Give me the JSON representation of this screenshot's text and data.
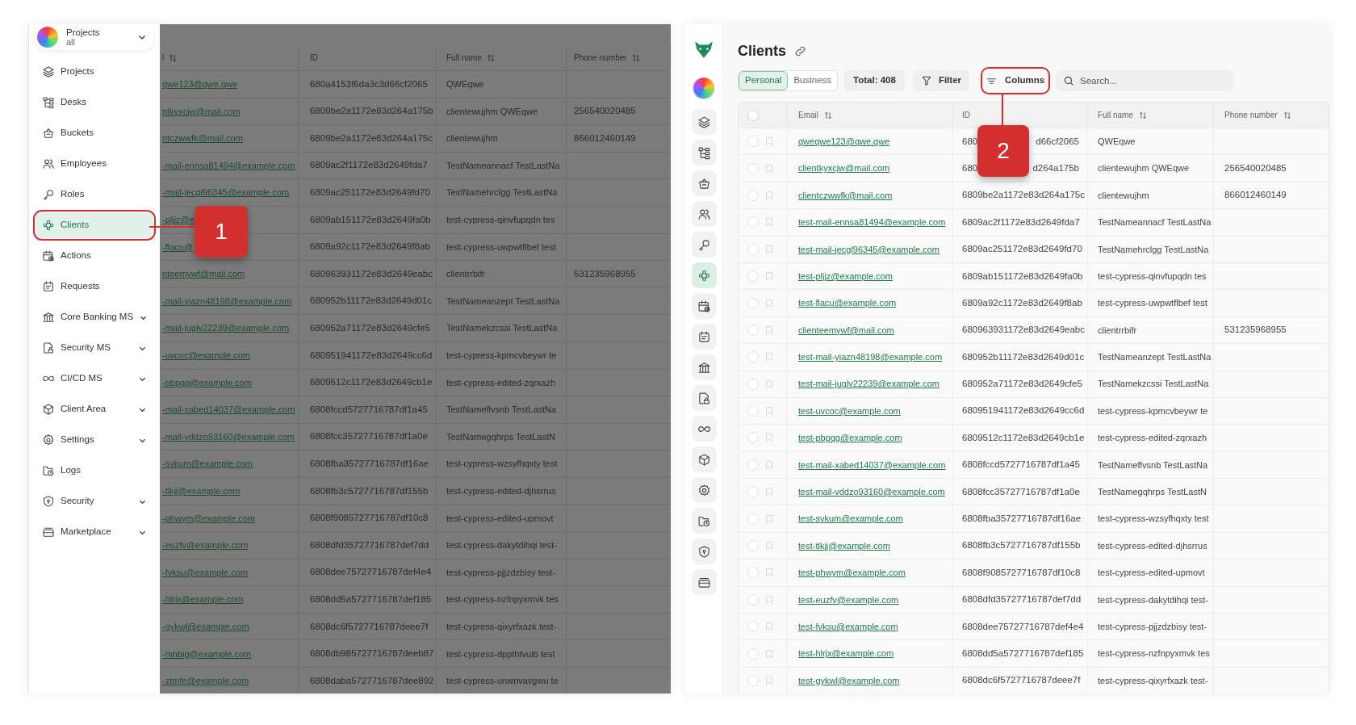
{
  "left_screen": {
    "project_selector": {
      "title": "Projects",
      "subtitle": "all"
    },
    "sidebar": {
      "items": [
        {
          "label": "Projects",
          "selected": false,
          "expandable": false
        },
        {
          "label": "Desks",
          "selected": false,
          "expandable": false
        },
        {
          "label": "Buckets",
          "selected": false,
          "expandable": false
        },
        {
          "label": "Employees",
          "selected": false,
          "expandable": false
        },
        {
          "label": "Roles",
          "selected": false,
          "expandable": false
        },
        {
          "label": "Clients",
          "selected": true,
          "expandable": false
        },
        {
          "label": "Actions",
          "selected": false,
          "expandable": false
        },
        {
          "label": "Requests",
          "selected": false,
          "expandable": false
        },
        {
          "label": "Core Banking MS",
          "selected": false,
          "expandable": true
        },
        {
          "label": "Security MS",
          "selected": false,
          "expandable": true
        },
        {
          "label": "CI/CD MS",
          "selected": false,
          "expandable": true
        },
        {
          "label": "Client Area",
          "selected": false,
          "expandable": true
        },
        {
          "label": "Settings",
          "selected": false,
          "expandable": true
        },
        {
          "label": "Logs",
          "selected": false,
          "expandable": false
        },
        {
          "label": "Security",
          "selected": false,
          "expandable": true
        },
        {
          "label": "Marketplace",
          "selected": false,
          "expandable": true
        }
      ]
    },
    "table": {
      "columns": [
        {
          "label": "l",
          "sortable": true
        },
        {
          "label": "ID",
          "sortable": false
        },
        {
          "label": "Full name",
          "sortable": true
        },
        {
          "label": "Phone number",
          "sortable": true
        }
      ],
      "rows": [
        {
          "email": "qwe123@qwe.qwe",
          "id": "680a4153f6da3c3d66cf2065",
          "full_name": "QWEqwe"
        },
        {
          "email": "ntkyxcjw@mail.com",
          "id": "6809be2a1172e83d264a175b",
          "full_name": "clientewujhm QWEqwe",
          "phone": "256540020485"
        },
        {
          "email": "ntczwwfk@mail.com",
          "id": "6809be2a1172e83d264a175c",
          "full_name": "clientewujhm",
          "phone": "866012460149"
        },
        {
          "email": "-mail-ennsa81494@example.com",
          "id": "6809ac2f1172e83d2649fda7",
          "full_name": "TestNameannacf TestLastNa"
        },
        {
          "email": "-mail-jecgl96345@example.com",
          "id": "6809ac251172e83d2649fd70",
          "full_name": "TestNamehrclgg TestLastNa"
        },
        {
          "email": "-pljjz@e",
          "id": "6809ab151172e83d2649fa0b",
          "full_name": "test-cypress-qinvfupqdn tes"
        },
        {
          "email": "-flacu@",
          "id": "6809a92c1172e83d2649f8ab",
          "full_name": "test-cypress-uwpwtflbef test"
        },
        {
          "email": "nteemywf@mail.com",
          "id": "680963931172e83d2649eabc",
          "full_name": "clientrrbifr",
          "phone": "531235968955"
        },
        {
          "email": "-mail-yiazn48198@example.com",
          "id": "680952b11172e83d2649d01c",
          "full_name": "TestNameanzept TestLastNa"
        },
        {
          "email": "-mail-juglv22239@example.com",
          "id": "680952a71172e83d2649cfe5",
          "full_name": "TestNamekzcssi TestLastNa"
        },
        {
          "email": "-uvcoc@example.com",
          "id": "680951941172e83d2649cc6d",
          "full_name": "test-cypress-kpmcvbeywr te"
        },
        {
          "email": "-pbpqg@example.com",
          "id": "6809512c1172e83d2649cb1e",
          "full_name": "test-cypress-edited-zqrxazh"
        },
        {
          "email": "-mail-xabed14037@example.com",
          "id": "6808fccd5727716787df1a45",
          "full_name": "TestNameflvsnb TestLastNa"
        },
        {
          "email": "-mail-vddzo93160@example.com",
          "id": "6808fcc35727716787df1a0e",
          "full_name": "TestNamegqhrps TestLastN"
        },
        {
          "email": "-svkum@example.com",
          "id": "6808fba35727716787df16ae",
          "full_name": "test-cypress-wzsyfhqxty test"
        },
        {
          "email": "-tlkjj@example.com",
          "id": "6808fb3c5727716787df155b",
          "full_name": "test-cypress-edited-djhsrrus"
        },
        {
          "email": "-phwym@example.com",
          "id": "6808f9085727716787df10c8",
          "full_name": "test-cypress-edited-upmovt"
        },
        {
          "email": "-euzfv@example.com",
          "id": "6808dfd35727716787def7dd",
          "full_name": "test-cypress-dakytdihqi test-"
        },
        {
          "email": "-fvksu@example.com",
          "id": "6808dee75727716787def4e4",
          "full_name": "test-cypress-pjjzdzbisy test-"
        },
        {
          "email": "-hlrjx@example.com",
          "id": "6808dd5a5727716787def185",
          "full_name": "test-cypress-nzfnpyxmvk tes"
        },
        {
          "email": "-gykwl@example.com",
          "id": "6808dc6f5727716787deee7f",
          "full_name": "test-cypress-qixyrfxazk test-"
        },
        {
          "email": "-mhbig@example.com",
          "id": "6808db985727716787deeb87",
          "full_name": "test-cypress-dppthtvuib test"
        },
        {
          "email": "-ztmfe@example.com",
          "id": "6808daba5727716787dee892",
          "full_name": "test-cypress-unwnvavgwu te"
        }
      ]
    }
  },
  "right_screen": {
    "rail": {
      "items": [
        {
          "selected": false
        },
        {
          "selected": false
        },
        {
          "selected": false
        },
        {
          "selected": false
        },
        {
          "selected": false
        },
        {
          "selected": true
        },
        {
          "selected": false
        },
        {
          "selected": false
        },
        {
          "selected": false
        },
        {
          "selected": false
        },
        {
          "selected": false
        },
        {
          "selected": false
        },
        {
          "selected": false
        },
        {
          "selected": false
        },
        {
          "selected": false
        },
        {
          "selected": false
        }
      ]
    },
    "title": "Clients",
    "tabs": [
      {
        "label": "Personal",
        "selected": true
      },
      {
        "label": "Business",
        "selected": false
      }
    ],
    "total": "Total: 408",
    "filter_button": "Filter",
    "columns_button": "Columns",
    "search": {
      "placeholder": "Search..."
    },
    "table": {
      "select_all_checked": false,
      "columns": [
        {
          "label": "Email",
          "sortable": true
        },
        {
          "label": "ID",
          "sortable": false
        },
        {
          "label": "Full name",
          "sortable": true
        },
        {
          "label": "Phone number",
          "sortable": true
        }
      ],
      "rows": [
        {
          "checked": false,
          "email": "qweqwe123@qwe.qwe",
          "id": "680",
          "id_tail": "d66cf2065",
          "full_name": "QWEqwe"
        },
        {
          "checked": false,
          "email": "clientkyxcjw@mail.com",
          "id": "680",
          "id_tail": "d264a175b",
          "full_name": "clientewujhm QWEqwe",
          "phone": "256540020485"
        },
        {
          "checked": false,
          "email": "clientczwwfk@mail.com",
          "id": "6809be2a1172e83d264a175c",
          "full_name": "clientewujhm",
          "phone": "866012460149"
        },
        {
          "checked": false,
          "email": "test-mail-ennsa81494@example.com",
          "id": "6809ac2f1172e83d2649fda7",
          "full_name": "TestNameannacf TestLastNa"
        },
        {
          "checked": false,
          "email": "test-mail-jecgl96345@example.com",
          "id": "6809ac251172e83d2649fd70",
          "full_name": "TestNamehrclgg TestLastNa"
        },
        {
          "checked": false,
          "email": "test-pljjz@example.com",
          "id": "6809ab151172e83d2649fa0b",
          "full_name": "test-cypress-qinvfupqdn tes"
        },
        {
          "checked": false,
          "email": "test-flacu@example.com",
          "id": "6809a92c1172e83d2649f8ab",
          "full_name": "test-cypress-uwpwtflbef test"
        },
        {
          "checked": false,
          "email": "clienteemywf@mail.com",
          "id": "680963931172e83d2649eabc",
          "full_name": "clientrrbifr",
          "phone": "531235968955"
        },
        {
          "checked": false,
          "email": "test-mail-yiazn48198@example.com",
          "id": "680952b11172e83d2649d01c",
          "full_name": "TestNameanzept TestLastNa"
        },
        {
          "checked": false,
          "email": "test-mail-juglv22239@example.com",
          "id": "680952a71172e83d2649cfe5",
          "full_name": "TestNamekzcssi TestLastNa"
        },
        {
          "checked": false,
          "email": "test-uvcoc@example.com",
          "id": "680951941172e83d2649cc6d",
          "full_name": "test-cypress-kpmcvbeywr te"
        },
        {
          "checked": false,
          "email": "test-pbpqg@example.com",
          "id": "6809512c1172e83d2649cb1e",
          "full_name": "test-cypress-edited-zqrxazh"
        },
        {
          "checked": false,
          "email": "test-mail-xabed14037@example.com",
          "id": "6808fccd5727716787df1a45",
          "full_name": "TestNameflvsnb TestLastNa"
        },
        {
          "checked": false,
          "email": "test-mail-vddzo93160@example.com",
          "id": "6808fcc35727716787df1a0e",
          "full_name": "TestNamegqhrps TestLastN"
        },
        {
          "checked": false,
          "email": "test-svkum@example.com",
          "id": "6808fba35727716787df16ae",
          "full_name": "test-cypress-wzsyfhqxty test"
        },
        {
          "checked": false,
          "email": "test-tlkjj@example.com",
          "id": "6808fb3c5727716787df155b",
          "full_name": "test-cypress-edited-djhsrrus"
        },
        {
          "checked": false,
          "email": "test-phwym@example.com",
          "id": "6808f9085727716787df10c8",
          "full_name": "test-cypress-edited-upmovt"
        },
        {
          "checked": false,
          "email": "test-euzfv@example.com",
          "id": "6808dfd35727716787def7dd",
          "full_name": "test-cypress-dakytdihqi test-"
        },
        {
          "checked": false,
          "email": "test-fvksu@example.com",
          "id": "6808dee75727716787def4e4",
          "full_name": "test-cypress-pjjzdzbisy test-"
        },
        {
          "checked": false,
          "email": "test-hlrjx@example.com",
          "id": "6808dd5a5727716787def185",
          "full_name": "test-cypress-nzfnpyxmvk tes"
        },
        {
          "checked": false,
          "email": "test-gykwl@example.com",
          "id": "6808dc6f5727716787deee7f",
          "full_name": "test-cypress-qixyrfxazk test-"
        }
      ]
    }
  },
  "annotations": [
    {
      "label": "1"
    },
    {
      "label": "2"
    }
  ]
}
